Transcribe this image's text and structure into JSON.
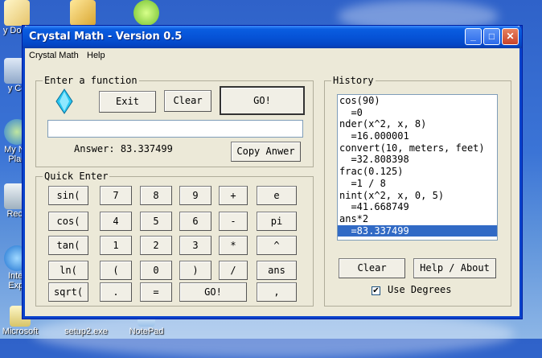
{
  "desktop": {
    "icons": [
      {
        "label": "y Docu",
        "name": "my-documents"
      },
      {
        "label": "y Co",
        "name": "my-computer"
      },
      {
        "label": "My Ne\nPlac",
        "name": "my-network-places"
      },
      {
        "label": "Recy",
        "name": "recycle-bin"
      },
      {
        "label": "Inter\nExpl",
        "name": "internet-explorer"
      },
      {
        "label": "Microsoft",
        "name": "microsoft"
      },
      {
        "label": "setup2.exe",
        "name": "setup2"
      },
      {
        "label": "NotePad",
        "name": "notepad"
      }
    ]
  },
  "window": {
    "title": "Crystal Math - Version 0.5",
    "controls": {
      "minimize": "_",
      "maximize": "□",
      "close": "✕"
    },
    "menu": [
      "Crystal Math",
      "Help"
    ]
  },
  "function_panel": {
    "label": "Enter a function",
    "exit_label": "Exit",
    "clear_label": "Clear",
    "go_label": "GO!",
    "input_value": "",
    "answer_label": "Answer:",
    "answer_value": "83.337499",
    "copy_label": "Copy Anwer"
  },
  "quick_enter": {
    "label": "Quick Enter",
    "rows": [
      [
        "sin(",
        "7",
        "8",
        "9",
        "+",
        "e"
      ],
      [
        "cos(",
        "4",
        "5",
        "6",
        "-",
        "pi"
      ],
      [
        "tan(",
        "1",
        "2",
        "3",
        "*",
        "^"
      ],
      [
        "ln(",
        "(",
        "0",
        ")",
        "/",
        "ans"
      ],
      [
        "sqrt(",
        ".",
        "=",
        "GO!",
        ","
      ]
    ]
  },
  "history": {
    "label": "History",
    "lines": [
      "cos(90)",
      "  =0",
      "nder(x^2, x, 8)",
      "  =16.000001",
      "convert(10, meters, feet)",
      "  =32.808398",
      "frac(0.125)",
      "  =1 / 8",
      "nint(x^2, x, 0, 5)",
      "  =41.668749",
      "ans*2",
      "  =83.337499"
    ],
    "selected_index": 11,
    "clear_label": "Clear",
    "help_label": "Help / About",
    "use_degrees_label": "Use Degrees",
    "use_degrees_checked": true
  }
}
